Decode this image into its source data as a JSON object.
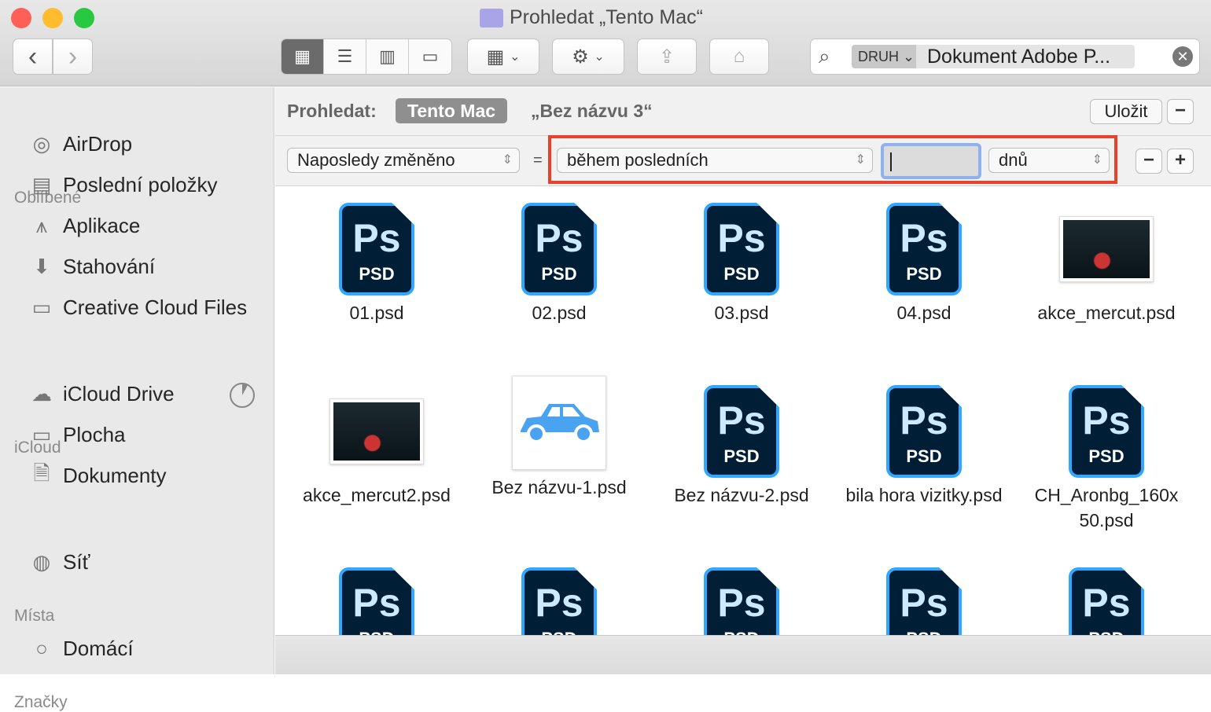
{
  "window": {
    "title": "Prohledat „Tento Mac“",
    "colors": {
      "close": "#fe5f57",
      "min": "#febc2e",
      "max": "#28c840",
      "accent": "#e8412c"
    }
  },
  "toolbar": {
    "back": "‹",
    "forward": "›",
    "search_kind": "DRUH",
    "search_value": "Dokument Adobe P..."
  },
  "sidebar": {
    "sections": [
      {
        "title": "Oblíbené",
        "items": [
          {
            "label": "AirDrop",
            "icon": "airdrop-icon"
          },
          {
            "label": "Poslední položky",
            "icon": "recents-icon"
          },
          {
            "label": "Aplikace",
            "icon": "applications-icon"
          },
          {
            "label": "Stahování",
            "icon": "downloads-icon"
          },
          {
            "label": "Creative Cloud Files",
            "icon": "folder-icon"
          }
        ]
      },
      {
        "title": "iCloud",
        "items": [
          {
            "label": "iCloud Drive",
            "icon": "cloud-icon"
          },
          {
            "label": "Plocha",
            "icon": "desktop-icon"
          },
          {
            "label": "Dokumenty",
            "icon": "document-icon"
          }
        ]
      },
      {
        "title": "Místa",
        "items": [
          {
            "label": "Síť",
            "icon": "network-icon"
          }
        ]
      },
      {
        "title": "Značky",
        "items": [
          {
            "label": "Domácí",
            "icon": "tag-circle-icon"
          }
        ]
      }
    ]
  },
  "scope": {
    "label": "Prohledat:",
    "active": "Tento Mac",
    "other": "„Bez názvu 3“",
    "save": "Uložit"
  },
  "criteria": {
    "attribute": "Naposledy změněno",
    "operator_sign": "=",
    "condition": "během posledních",
    "value": "",
    "unit": "dnů"
  },
  "files": [
    {
      "name": "01.psd",
      "type": "psd"
    },
    {
      "name": "02.psd",
      "type": "psd"
    },
    {
      "name": "03.psd",
      "type": "psd"
    },
    {
      "name": "04.psd",
      "type": "psd"
    },
    {
      "name": "akce_mercut.psd",
      "type": "photo"
    },
    {
      "name": "akce_mercut2.psd",
      "type": "photo"
    },
    {
      "name": "Bez názvu-1.psd",
      "type": "car"
    },
    {
      "name": "Bez názvu-2.psd",
      "type": "psd"
    },
    {
      "name": "bila hora vizitky.psd",
      "type": "psd"
    },
    {
      "name": "CH_Aronbg_160x 50.psd",
      "type": "psd"
    },
    {
      "name": "",
      "type": "psd"
    },
    {
      "name": "",
      "type": "psd"
    },
    {
      "name": "",
      "type": "psd"
    },
    {
      "name": "",
      "type": "psd"
    },
    {
      "name": "",
      "type": "psd"
    }
  ],
  "psd_icon": {
    "big": "Ps",
    "small": "PSD"
  }
}
